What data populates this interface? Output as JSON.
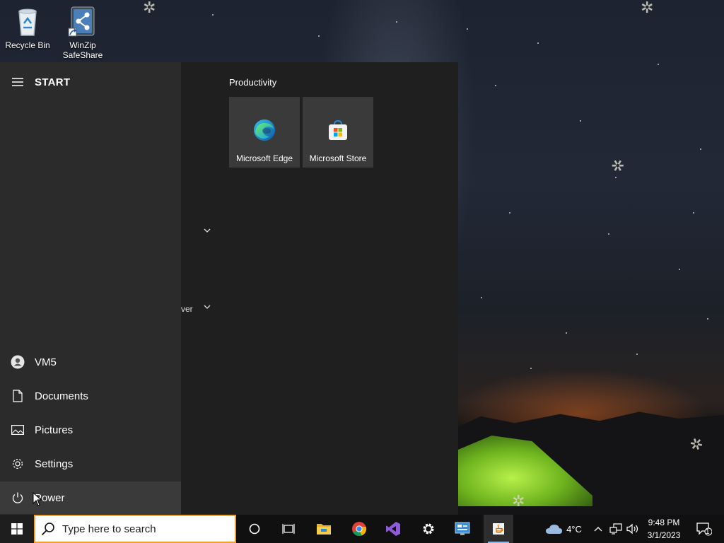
{
  "desktop": {
    "icons": [
      {
        "label": "Recycle Bin"
      },
      {
        "label": "WinZip\nSafeShare"
      }
    ]
  },
  "start_menu": {
    "title": "START",
    "group_title": "Productivity",
    "tiles": [
      {
        "label": "Microsoft Edge",
        "icon": "edge-icon"
      },
      {
        "label": "Microsoft Store",
        "icon": "store-icon"
      }
    ],
    "partial_text": "ver",
    "rail": [
      {
        "label": "VM5",
        "icon": "user-icon"
      },
      {
        "label": "Documents",
        "icon": "document-icon"
      },
      {
        "label": "Pictures",
        "icon": "pictures-icon"
      },
      {
        "label": "Settings",
        "icon": "gear-icon"
      },
      {
        "label": "Power",
        "icon": "power-icon"
      }
    ]
  },
  "taskbar": {
    "search_placeholder": "Type here to search",
    "pinned": [
      "cortana-icon",
      "task-view-icon",
      "file-explorer-icon",
      "chrome-icon",
      "visual-studio-icon",
      "settings-icon",
      "control-panel-icon",
      "java-icon"
    ],
    "weather": "4°C",
    "time": "9:48 PM",
    "date": "3/1/2023",
    "notification_count": "1"
  },
  "colors": {
    "start_rail": "#2b2b2b",
    "start_content": "#1f1f1f",
    "tile": "#3a3a3a",
    "taskbar": "#101010",
    "search_border": "#f0a030"
  }
}
